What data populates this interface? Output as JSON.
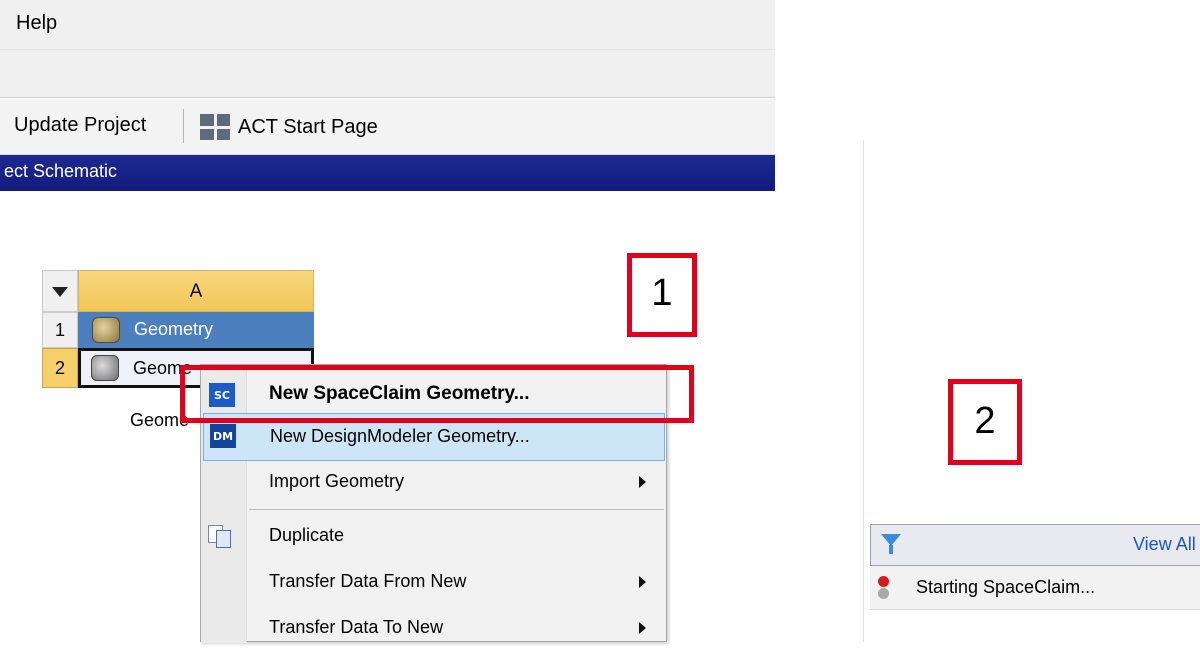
{
  "menubar": {
    "help_label": "Help"
  },
  "toolbar": {
    "update_label": "Update Project",
    "act_label": "ACT Start Page"
  },
  "schematic": {
    "title": "ect Schematic",
    "column_header": "A",
    "rows": [
      {
        "num": "1",
        "label": "Geometry"
      },
      {
        "num": "2",
        "label": "Geome"
      }
    ],
    "system_name": "Geome"
  },
  "context_menu": {
    "items": [
      {
        "label": "New SpaceClaim Geometry...",
        "icon": "SC"
      },
      {
        "label": "New DesignModeler Geometry...",
        "icon": "DM"
      },
      {
        "label": "Import Geometry"
      },
      {
        "label": "Duplicate"
      },
      {
        "label": "Transfer Data From New"
      },
      {
        "label": "Transfer Data To New"
      }
    ]
  },
  "callouts": {
    "one": "1",
    "two": "2"
  },
  "messages_panel": {
    "view_all": "View All",
    "status": "Starting SpaceClaim..."
  },
  "colors": {
    "title_bar": "#1a2587",
    "highlight_red": "#e3001b",
    "selected_row": "#4b7fbd",
    "header_yellow": "#f3c658"
  }
}
